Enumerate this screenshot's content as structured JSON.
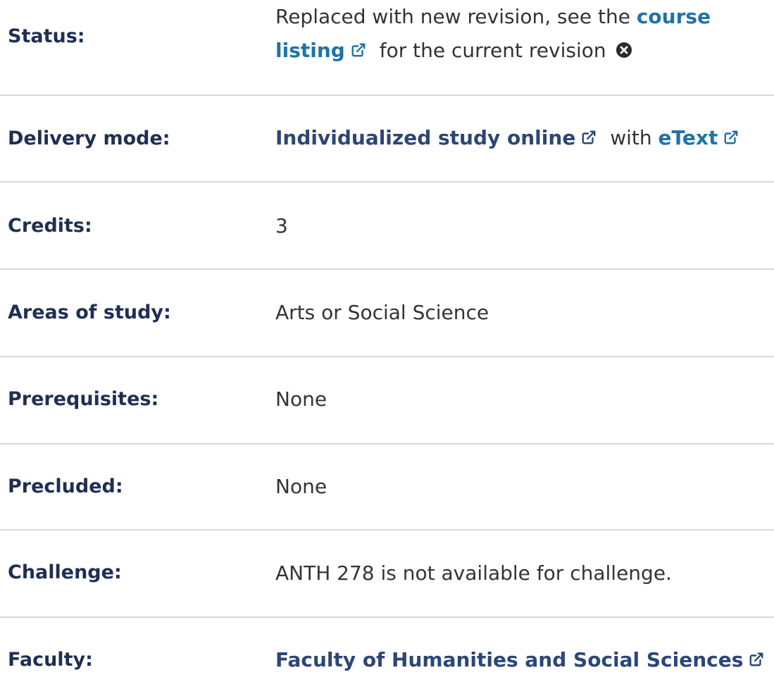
{
  "rows": {
    "status": {
      "label": "Status:",
      "text_before": "Replaced with new revision, see the",
      "link_line1": "course",
      "link_line2": "listing",
      "text_after": "for the current revision"
    },
    "delivery": {
      "label": "Delivery mode:",
      "link1": "Individualized study online",
      "mid": "with",
      "link2": "eText"
    },
    "credits": {
      "label": "Credits:",
      "value": "3"
    },
    "areas": {
      "label": "Areas of study:",
      "value": "Arts or Social Science"
    },
    "prereq": {
      "label": "Prerequisites:",
      "value": "None"
    },
    "precluded": {
      "label": "Precluded:",
      "value": "None"
    },
    "challenge": {
      "label": "Challenge:",
      "value": "ANTH 278 is not available for challenge."
    },
    "faculty": {
      "label": "Faculty:",
      "link": "Faculty of Humanities and Social Sciences"
    }
  },
  "icons": {
    "external": "external-link-icon",
    "close": "times-circle-icon"
  },
  "colors": {
    "label": "#1f2f52",
    "link": "#1f73a8",
    "link_dark": "#2c4676",
    "text": "#333333",
    "divider": "#d6d8dc"
  }
}
